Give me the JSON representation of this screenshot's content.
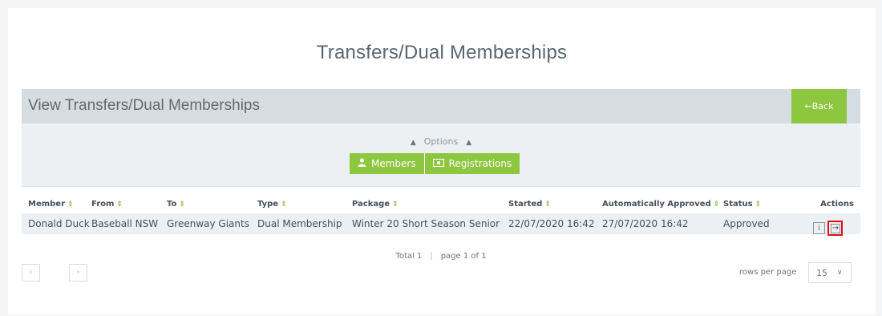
{
  "page_title": "Transfers/Dual Memberships",
  "panel": {
    "title": "View Transfers/Dual Memberships",
    "back_label": "←Back",
    "options_label": "Options",
    "buttons": [
      {
        "label": "Members",
        "icon": "person-icon"
      },
      {
        "label": "Registrations",
        "icon": "money-icon"
      }
    ]
  },
  "table": {
    "columns": [
      "Member",
      "From",
      "To",
      "Type",
      "Package",
      "Started",
      "Automatically Approved",
      "Status",
      "Actions"
    ],
    "rows": [
      {
        "member": "Donald Duck",
        "from": "Baseball NSW",
        "to": "Greenway Giants",
        "type": "Dual Membership",
        "package": "Winter 20 Short Season Senior",
        "started": "22/07/2020 16:42",
        "auto_approved": "27/07/2020 16:42",
        "status": "Approved"
      }
    ]
  },
  "pager": {
    "total": "Total 1",
    "page": "page 1 of 1",
    "rows_per_page_label": "rows per page",
    "rows_per_page_value": "15"
  },
  "colors": {
    "accent": "#8dc63f",
    "header_bg": "#d6dde2",
    "highlight": "#e20e1a"
  }
}
